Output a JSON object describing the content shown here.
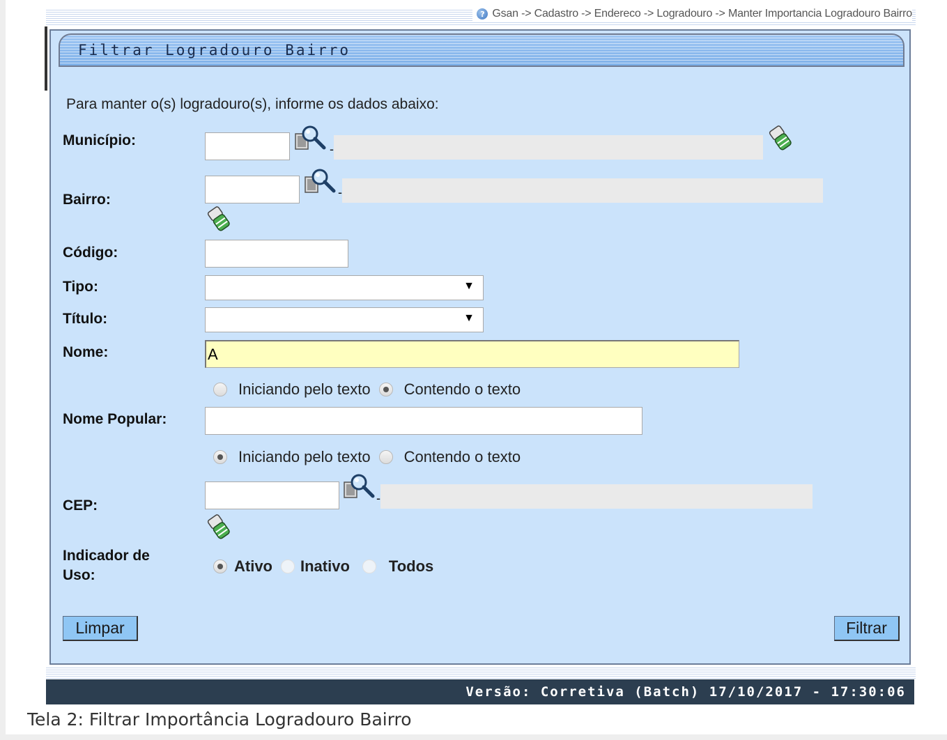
{
  "breadcrumb": "Gsan -> Cadastro -> Endereco -> Logradouro -> Manter Importancia Logradouro Bairro",
  "panel": {
    "title": "Filtrar Logradouro Bairro",
    "instruction": "Para manter o(s) logradouro(s), informe os dados abaixo:"
  },
  "form": {
    "municipio": {
      "label": "Município:",
      "value": ""
    },
    "bairro": {
      "label": "Bairro:",
      "value": ""
    },
    "codigo": {
      "label": "Código:",
      "value": ""
    },
    "tipo": {
      "label": "Tipo:",
      "selected": ""
    },
    "titulo": {
      "label": "Título:",
      "selected": ""
    },
    "nome": {
      "label": "Nome:",
      "value": "A"
    },
    "nome_opts": {
      "starts": "Iniciando pelo texto",
      "contains": "Contendo o texto",
      "selected": "contains"
    },
    "nome_popular": {
      "label": "Nome Popular:",
      "value": ""
    },
    "nome_popular_opts": {
      "starts": "Iniciando pelo texto",
      "contains": "Contendo o texto",
      "selected": "starts"
    },
    "cep": {
      "label": "CEP:",
      "value": ""
    },
    "indicador": {
      "label_line1": "Indicador de",
      "label_line2": "Uso:",
      "ativo": "Ativo",
      "inativo": "Inativo",
      "todos": "Todos",
      "selected": "ativo"
    },
    "dash": "-"
  },
  "buttons": {
    "limpar": "Limpar",
    "filtrar": "Filtrar"
  },
  "version": "Versão: Corretiva (Batch) 17/10/2017 - 17:30:06",
  "caption": "Tela 2: Filtrar Importância Logradouro Bairro",
  "icons": {
    "help": "help-icon",
    "search": "magnifier-search-icon",
    "clear": "eraser-icon"
  },
  "colors": {
    "panel": "#cbe3fb",
    "title_bar": "#8ebcef",
    "button": "#8fc6f4",
    "version_bar": "#2c3e50",
    "highlight_input": "#ffffc0"
  }
}
